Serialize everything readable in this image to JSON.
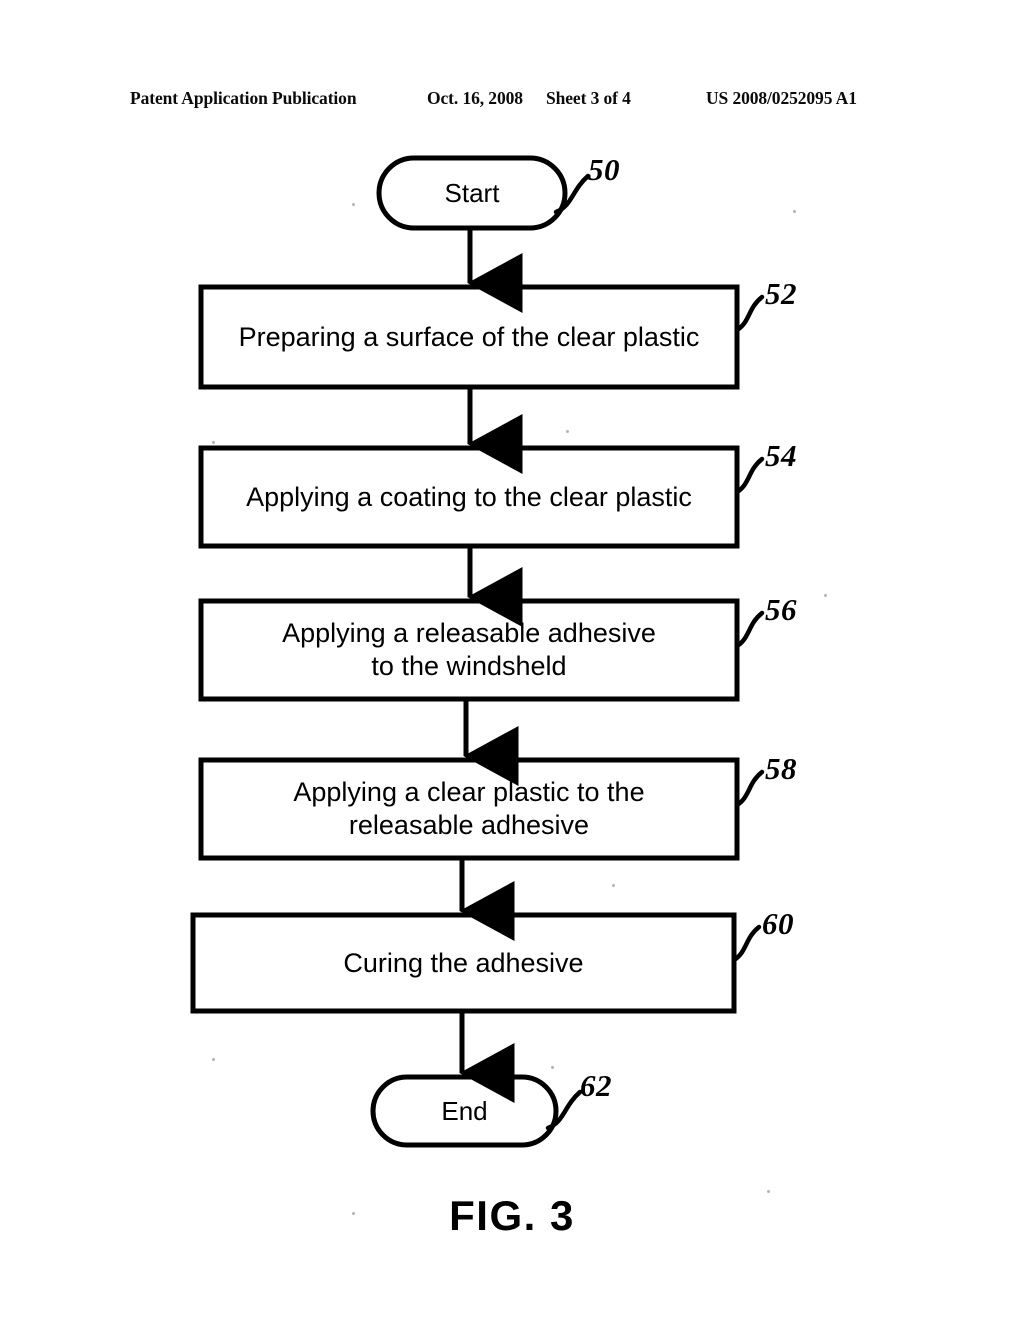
{
  "header": {
    "publication": "Patent Application Publication",
    "date": "Oct. 16, 2008",
    "sheet": "Sheet 3 of 4",
    "publication_number": "US 2008/0252095 A1"
  },
  "figure": {
    "caption": "FIG. 3",
    "type": "flowchart",
    "line_color": "#000000",
    "fill_color": "#ffffff"
  },
  "flowchart": {
    "nodes": [
      {
        "id": "start",
        "shape": "terminal",
        "label": "Start",
        "ref": "50"
      },
      {
        "id": "step52",
        "shape": "process",
        "label": "Preparing a surface of the clear plastic",
        "ref": "52"
      },
      {
        "id": "step54",
        "shape": "process",
        "label": "Applying a coating to the clear plastic",
        "ref": "54"
      },
      {
        "id": "step56",
        "shape": "process",
        "label": "Applying a releasable adhesive\nto the windsheld",
        "ref": "56"
      },
      {
        "id": "step58",
        "shape": "process",
        "label": "Applying a clear plastic to the\nreleasable adhesive",
        "ref": "58"
      },
      {
        "id": "step60",
        "shape": "process",
        "label": "Curing the adhesive",
        "ref": "60"
      },
      {
        "id": "end",
        "shape": "terminal",
        "label": "End",
        "ref": "62"
      }
    ],
    "edges": [
      {
        "from": "start",
        "to": "step52",
        "arrow": "down"
      },
      {
        "from": "step52",
        "to": "step54",
        "arrow": "down"
      },
      {
        "from": "step54",
        "to": "step56",
        "arrow": "down"
      },
      {
        "from": "step56",
        "to": "step58",
        "arrow": "down"
      },
      {
        "from": "step58",
        "to": "step60",
        "arrow": "down"
      },
      {
        "from": "step60",
        "to": "end",
        "arrow": "down"
      }
    ]
  }
}
